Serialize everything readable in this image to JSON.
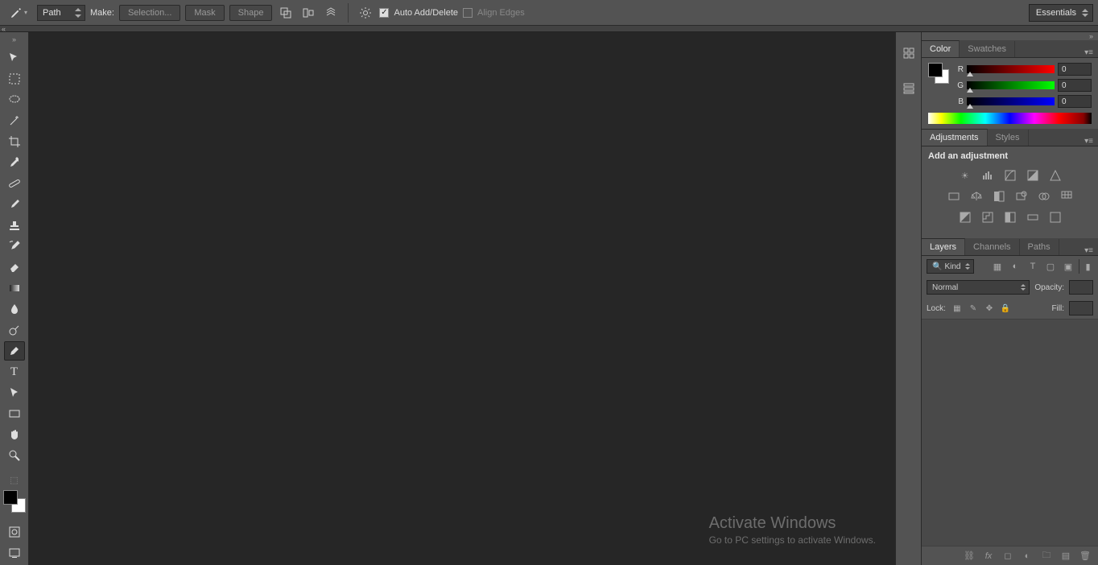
{
  "optionsBar": {
    "pathMode": "Path",
    "makeLabel": "Make:",
    "selectionBtn": "Selection...",
    "maskBtn": "Mask",
    "shapeBtn": "Shape",
    "autoAddDelete": "Auto Add/Delete",
    "alignEdges": "Align Edges",
    "workspace": "Essentials"
  },
  "colorPanel": {
    "tabColor": "Color",
    "tabSwatches": "Swatches",
    "r": {
      "label": "R",
      "value": "0"
    },
    "g": {
      "label": "G",
      "value": "0"
    },
    "b": {
      "label": "B",
      "value": "0"
    }
  },
  "adjustments": {
    "tabAdjustments": "Adjustments",
    "tabStyles": "Styles",
    "title": "Add an adjustment"
  },
  "layers": {
    "tabLayers": "Layers",
    "tabChannels": "Channels",
    "tabPaths": "Paths",
    "kind": "Kind",
    "blendMode": "Normal",
    "opacityLabel": "Opacity:",
    "lockLabel": "Lock:",
    "fillLabel": "Fill:"
  },
  "watermark": {
    "title": "Activate Windows",
    "sub": "Go to PC settings to activate Windows."
  }
}
